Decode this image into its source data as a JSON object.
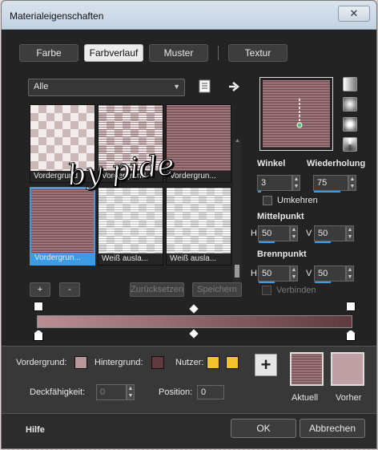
{
  "window": {
    "title": "Materialeigenschaften",
    "close_glyph": "✕"
  },
  "tabs": [
    {
      "label": "Farbe",
      "active": false
    },
    {
      "label": "Farbverlauf",
      "active": true
    },
    {
      "label": "Muster",
      "active": false
    },
    {
      "label": "Textur",
      "active": false
    }
  ],
  "gallery": {
    "filter": "Alle",
    "thumbnails": [
      {
        "label": "Vordergrund",
        "selected": false
      },
      {
        "label": "Vordergrund",
        "selected": false
      },
      {
        "label": "Vordergrun...",
        "selected": false
      },
      {
        "label": "Vordergrun...",
        "selected": true
      },
      {
        "label": "Weiß ausla...",
        "selected": false
      },
      {
        "label": "Weiß ausla...",
        "selected": false
      }
    ],
    "add_label": "+",
    "remove_label": "-",
    "reset_label": "Zurücksetzen",
    "save_label": "Speichern"
  },
  "watermark": "by pide",
  "settings": {
    "angle_label": "Winkel",
    "angle_value": "3",
    "repeat_label": "Wiederholung",
    "repeat_value": "75",
    "invert_label": "Umkehren",
    "center_label": "Mittelpunkt",
    "center_h_label": "H",
    "center_h_value": "50",
    "center_v_label": "V",
    "center_v_value": "50",
    "focus_label": "Brennpunkt",
    "focus_h_label": "H",
    "focus_h_value": "50",
    "focus_v_label": "V",
    "focus_v_value": "50",
    "link_label": "Verbinden"
  },
  "colors": {
    "accent": "#3a9be6",
    "foreground": "#b8979a",
    "background": "#5e3a3e",
    "user": "#f2c12e",
    "gradient_start": "#b98f94",
    "gradient_end": "#5f3b40"
  },
  "bottom": {
    "fg_label": "Vordergrund:",
    "bg_label": "Hintergrund:",
    "user_label": "Nutzer:",
    "opacity_label": "Deckfähigkeit:",
    "opacity_value": "0",
    "position_label": "Position:",
    "position_value": "0",
    "add_glyph": "+",
    "current_label": "Aktuell",
    "previous_label": "Vorher"
  },
  "footer": {
    "help": "Hilfe",
    "ok": "OK",
    "cancel": "Abbrechen"
  }
}
